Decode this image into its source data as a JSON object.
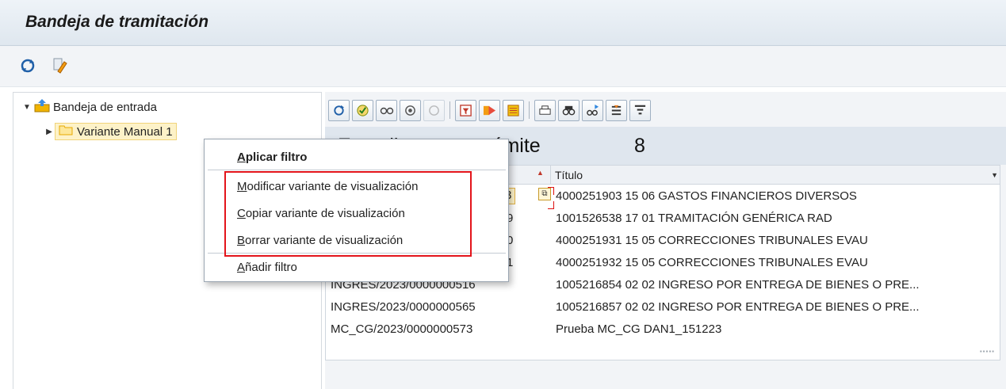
{
  "window": {
    "title": "Bandeja de tramitación"
  },
  "appbar": {
    "icons": [
      "refresh-icon",
      "edit-pencil-icon"
    ]
  },
  "tree": {
    "root": {
      "label": "Bandeja de entrada",
      "icon": "inbox-icon"
    },
    "children": [
      {
        "label": "Variante Manual 1",
        "icon": "folder-icon"
      }
    ]
  },
  "toolbar": {
    "buttons": [
      "refresh-icon",
      "check-icon",
      "glasses-icon",
      "settings-icon",
      "settings-disabled-icon",
      "filter-table-icon",
      "play-icon",
      "stamp-icon",
      "print-icon",
      "find-icon",
      "find-next-icon",
      "sum-icon",
      "filter-icon"
    ]
  },
  "list": {
    "title": "Expedientes en trámite",
    "count": "8",
    "column_title": "Título",
    "rows": [
      {
        "id": "3",
        "titulo": "4000251903 15 06 GASTOS FINANCIEROS DIVERSOS"
      },
      {
        "id": "9",
        "titulo": "1001526538 17 01 TRAMITACIÓN GENÉRICA RAD"
      },
      {
        "id": "0",
        "titulo": "4000251931 15 05 CORRECCIONES TRIBUNALES EVAU"
      },
      {
        "id": "1",
        "titulo": "4000251932 15 05 CORRECCIONES TRIBUNALES EVAU"
      },
      {
        "id": "INGRES/2023/0000000516",
        "titulo": "1005216854 02 02 INGRESO POR ENTREGA DE BIENES O PRE..."
      },
      {
        "id": "INGRES/2023/0000000565",
        "titulo": "1005216857 02 02 INGRESO POR ENTREGA DE BIENES O PRE..."
      },
      {
        "id": "MC_CG/2023/0000000573",
        "titulo": "Prueba MC_CG DAN1_151223"
      }
    ]
  },
  "context_menu": {
    "apply": {
      "u": "A",
      "rest": "plicar filtro"
    },
    "modify": {
      "u": "M",
      "rest": "odificar variante de visualización"
    },
    "copy": {
      "u": "C",
      "rest": "opiar variante de visualización"
    },
    "delete": {
      "u": "B",
      "rest": "orrar variante de visualización"
    },
    "add": {
      "u": "A",
      "rest": "ñadir filtro"
    }
  },
  "colors": {
    "highlight_border": "#e3141b",
    "selection_bg": "#fdf2c8",
    "header_bg": "#dfe6ee"
  }
}
